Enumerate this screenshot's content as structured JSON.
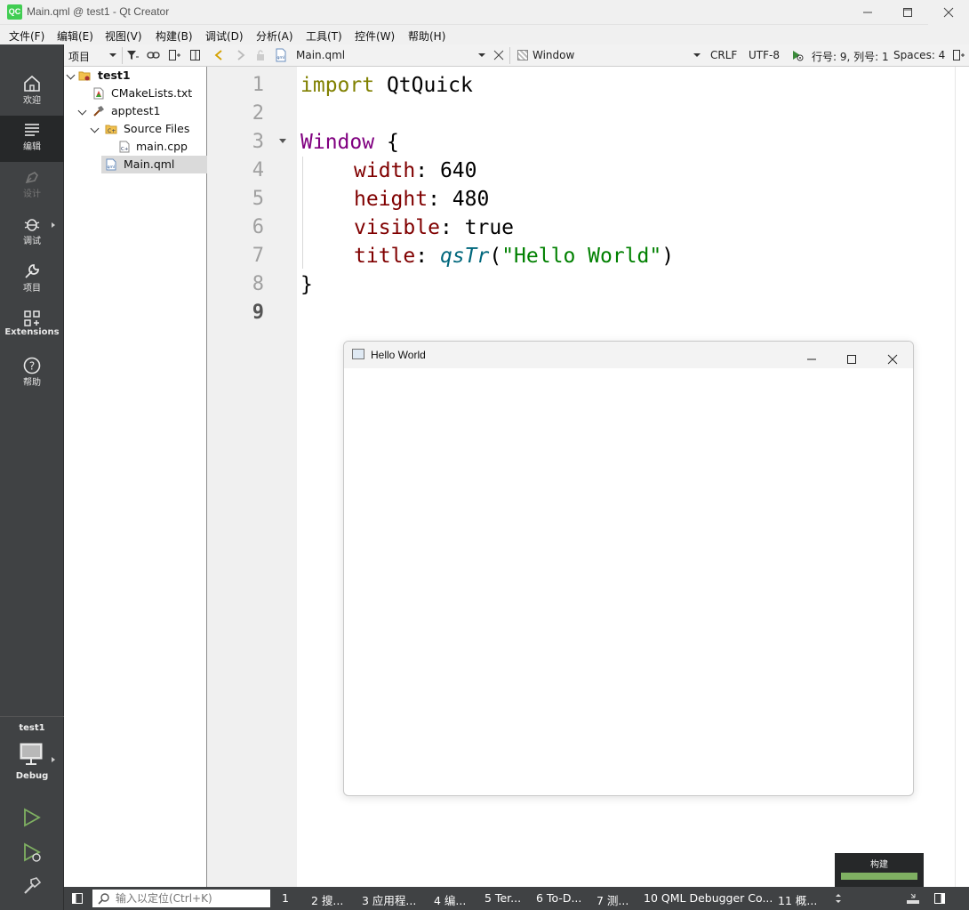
{
  "window": {
    "title": "Main.qml @ test1 - Qt Creator",
    "logo_text": "QC"
  },
  "menu": [
    "文件(F)",
    "编辑(E)",
    "视图(V)",
    "构建(B)",
    "调试(D)",
    "分析(A)",
    "工具(T)",
    "控件(W)",
    "帮助(H)"
  ],
  "modes": [
    {
      "label": "欢迎",
      "icon": "home-icon"
    },
    {
      "label": "编辑",
      "icon": "edit-lines-icon"
    },
    {
      "label": "设计",
      "icon": "pen-icon"
    },
    {
      "label": "调试",
      "icon": "bug-icon"
    },
    {
      "label": "项目",
      "icon": "wrench-icon"
    },
    {
      "label": "Extensions",
      "icon": "extensions-icon"
    },
    {
      "label": "帮助",
      "icon": "help-icon"
    }
  ],
  "kit": {
    "project": "test1",
    "config": "Debug"
  },
  "project_pane": {
    "view_label": "项目",
    "tree": [
      {
        "label": "test1",
        "bold": true,
        "icon": "project-folder-icon"
      },
      {
        "label": "CMakeLists.txt",
        "icon": "cmake-file-icon"
      },
      {
        "label": "apptest1",
        "icon": "hammer-icon"
      },
      {
        "label": "Source Files",
        "icon": "source-folder-icon"
      },
      {
        "label": "main.cpp",
        "icon": "cpp-file-icon"
      },
      {
        "label": "Main.qml",
        "icon": "qml-file-icon",
        "selected": true
      }
    ]
  },
  "editor_toolbar": {
    "file": "Main.qml",
    "symbol": "Window",
    "line_ending": "CRLF",
    "encoding": "UTF-8",
    "position": "行号: 9, 列号: 1",
    "indent": "Spaces: 4"
  },
  "code": {
    "line_numbers": [
      "1",
      "2",
      "3",
      "4",
      "5",
      "6",
      "7",
      "8",
      "9"
    ],
    "current_line": 9,
    "l1_kw": "import",
    "l1_rest": " QtQuick",
    "l3_type": "Window",
    "l3_rest": " {",
    "l4_prop": "width",
    "l4_rest": ": 640",
    "l5_prop": "height",
    "l5_rest": ": 480",
    "l6_prop": "visible",
    "l6_rest": ": true",
    "l7_prop": "title",
    "l7_colon": ": ",
    "l7_func": "qsTr",
    "l7_open": "(",
    "l7_str": "\"Hello World\"",
    "l7_close": ")",
    "l8": "}"
  },
  "running_app": {
    "title": "Hello World"
  },
  "statusbar": {
    "locator_placeholder": "输入以定位(Ctrl+K)",
    "panes": [
      "1",
      "2 搜...",
      "3 应用程...",
      "4 编...",
      "5 Ter...",
      "6 To-D...",
      "7 测...",
      "10 QML Debugger Co...",
      "11 概..."
    ]
  },
  "build": {
    "label": "构建",
    "progress": 1.0,
    "color": "#7fb062"
  },
  "colors": {
    "sidebar": "#404244",
    "sidebar_active": "#262829",
    "keyword_import": "#808000",
    "keyword_type": "#800080",
    "property": "#800000",
    "string": "#008000",
    "function": "#00677c"
  }
}
